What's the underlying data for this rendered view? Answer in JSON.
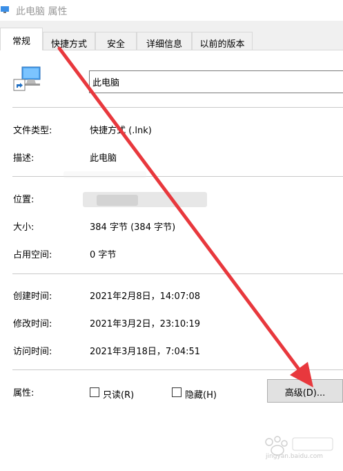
{
  "window": {
    "title": "此电脑 属性"
  },
  "tabs": [
    {
      "label": "常规",
      "active": true
    },
    {
      "label": "快捷方式",
      "active": false
    },
    {
      "label": "安全",
      "active": false
    },
    {
      "label": "详细信息",
      "active": false
    },
    {
      "label": "以前的版本",
      "active": false
    }
  ],
  "general": {
    "name": "此电脑",
    "file_type_label": "文件类型:",
    "file_type_value": "快捷方式 (.lnk)",
    "description_label": "描述:",
    "description_value": "此电脑",
    "location_label": "位置:",
    "size_label": "大小:",
    "size_value": "384 字节 (384 字节)",
    "disk_size_label": "占用空间:",
    "disk_size_value": "0 字节",
    "created_label": "创建时间:",
    "created_value": "2021年2月8日，14:07:08",
    "modified_label": "修改时间:",
    "modified_value": "2021年3月2日，23:10:19",
    "accessed_label": "访问时间:",
    "accessed_value": "2021年3月18日，7:04:51",
    "attributes_label": "属性:",
    "readonly_label": "只读(R)",
    "hidden_label": "隐藏(H)",
    "advanced_label": "高级(D)..."
  },
  "watermark": {
    "text": "jingyan.baidu.com"
  },
  "colors": {
    "arrow": "#e8383d",
    "watermark": "#c8c8c8"
  }
}
